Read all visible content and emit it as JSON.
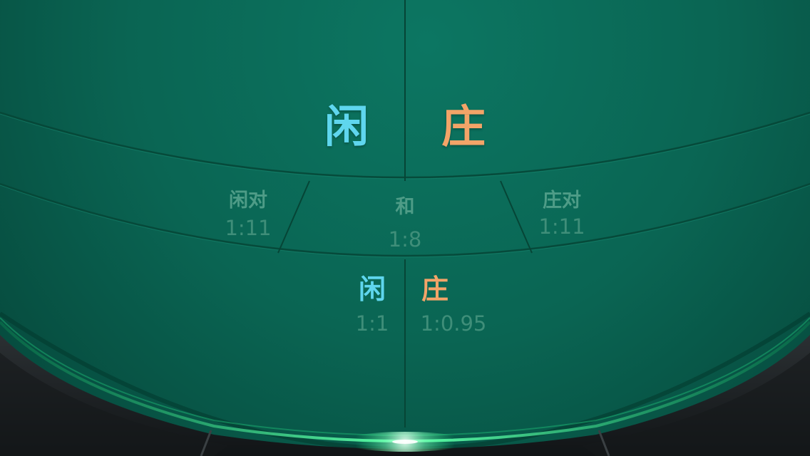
{
  "colors": {
    "felt": "#0b6a58",
    "player_accent": "#5fd6ee",
    "banker_accent": "#f3a468",
    "muted_text": "#4e9c87",
    "rail_glow": "#22e08a",
    "rail_leather": "#1e2224"
  },
  "main_bets": {
    "player_label": "闲",
    "banker_label": "庄"
  },
  "side_bets": {
    "player_pair": {
      "label": "闲对",
      "odds": "1:11"
    },
    "tie": {
      "label": "和",
      "odds": "1:8"
    },
    "banker_pair": {
      "label": "庄对",
      "odds": "1:11"
    }
  },
  "bottom_bets": {
    "player": {
      "label": "闲",
      "odds": "1:1"
    },
    "banker": {
      "label": "庄",
      "odds": "1:0.95"
    }
  }
}
